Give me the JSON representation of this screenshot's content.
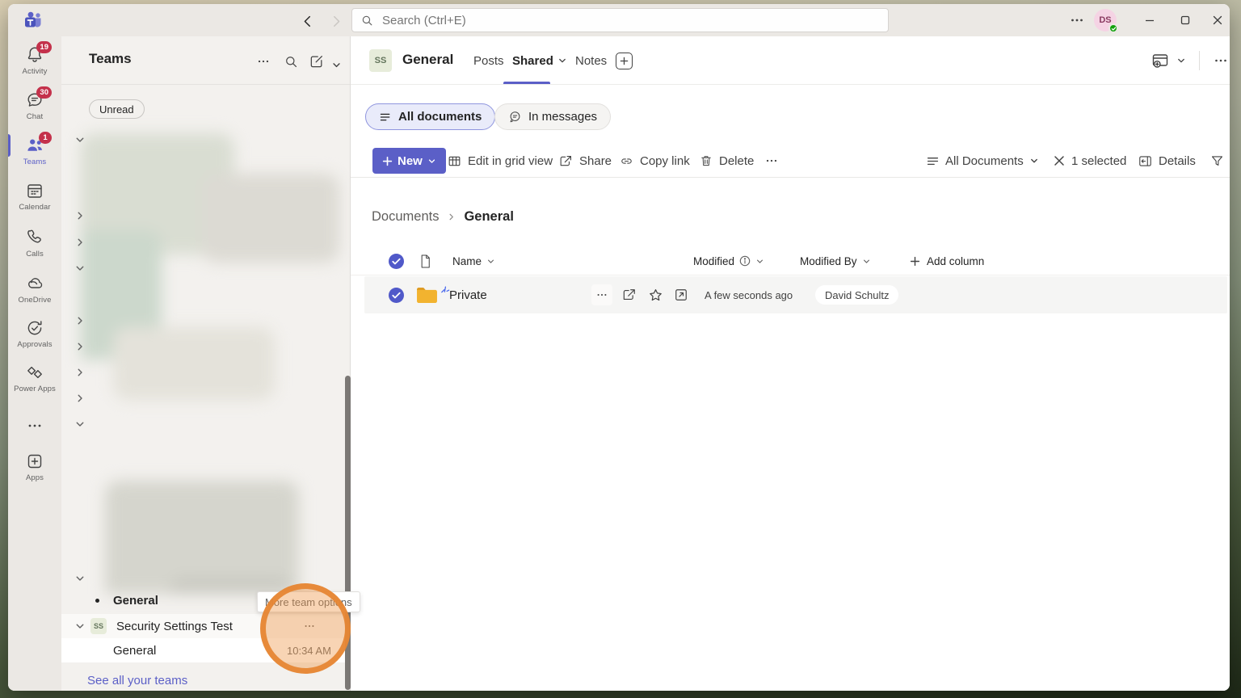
{
  "titlebar": {
    "search_placeholder": "Search (Ctrl+E)",
    "avatar_initials": "DS"
  },
  "rail": {
    "items": [
      {
        "label": "Activity",
        "badge": "19"
      },
      {
        "label": "Chat",
        "badge": "30"
      },
      {
        "label": "Teams",
        "badge": "1"
      },
      {
        "label": "Calendar"
      },
      {
        "label": "Calls"
      },
      {
        "label": "OneDrive"
      },
      {
        "label": "Approvals"
      },
      {
        "label": "Power Apps"
      },
      {
        "label": ""
      },
      {
        "label": "Apps"
      }
    ]
  },
  "sidebar": {
    "title": "Teams",
    "unread_filter": "Unread",
    "tooltip": "More team options",
    "bottom": {
      "unread_channel": "General",
      "team_name": "Security Settings Test",
      "team_initials": "SS",
      "channel": "General",
      "timestamp": "10:34 AM",
      "see_all": "See all your teams"
    }
  },
  "main": {
    "header": {
      "team_initials": "SS",
      "title": "General",
      "tabs": [
        {
          "label": "Posts"
        },
        {
          "label": "Shared"
        },
        {
          "label": "Notes"
        }
      ]
    },
    "filters": [
      {
        "label": "All documents"
      },
      {
        "label": "In messages"
      }
    ],
    "toolbar": {
      "new_label": "New",
      "actions": [
        "Edit in grid view",
        "Share",
        "Copy link",
        "Delete"
      ],
      "view_selector": "All Documents",
      "selected_count": "1 selected",
      "details_label": "Details"
    },
    "breadcrumb": [
      "Documents",
      "General"
    ],
    "table": {
      "columns": [
        "Name",
        "Modified",
        "Modified By"
      ],
      "add_column": "Add column",
      "rows": [
        {
          "name": "Private",
          "modified": "A few seconds ago",
          "modified_by": "David Schultz"
        }
      ]
    }
  },
  "colors": {
    "accent": "#5b5fc7",
    "badge_red": "#c4314b",
    "selection_blue": "#5059c9",
    "folder_yellow": "#f2b32f",
    "annotation_orange": "#e8893a",
    "presence_green": "#13a10e"
  }
}
